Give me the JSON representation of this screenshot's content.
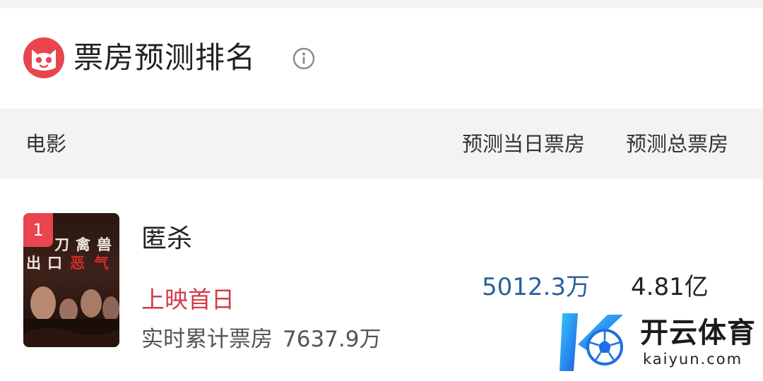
{
  "header": {
    "title": "票房预测排名",
    "logo_icon": "maoyan-cat-logo",
    "info_icon": "info-icon"
  },
  "columns": {
    "film": "电影",
    "today": "预测当日票房",
    "total": "预测总票房"
  },
  "rows": [
    {
      "rank": "1",
      "title": "匿杀",
      "poster_text": [
        "刀",
        "禽",
        "兽",
        "出",
        "口",
        "恶",
        "气"
      ],
      "release_tag": "上映首日",
      "realtime_label": "实时累计票房",
      "realtime_value": "7637.9万",
      "today_forecast": "5012.3万",
      "total_forecast": "4.81亿"
    }
  ],
  "watermark": {
    "name": "开云体育",
    "domain": "kaiyun.com"
  },
  "colors": {
    "accent_red": "#e8454f",
    "release_red": "#d23b4a",
    "forecast_blue": "#2b5f9e",
    "header_gray": "#f3f3f3"
  }
}
